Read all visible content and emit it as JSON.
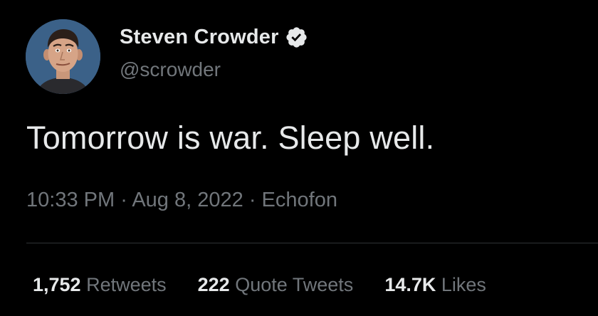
{
  "author": {
    "display_name": "Steven Crowder",
    "handle": "@scrowder",
    "verified": true,
    "avatar_icon": "profile-photo"
  },
  "tweet": {
    "text": "Tomorrow is war. Sleep well.",
    "time": "10:33 PM",
    "date": "Aug 8, 2022",
    "source": "Echofon",
    "separator": "·"
  },
  "stats": {
    "retweets_count": "1,752",
    "retweets_label": "Retweets",
    "quotes_count": "222",
    "quotes_label": "Quote Tweets",
    "likes_count": "14.7K",
    "likes_label": "Likes"
  },
  "colors": {
    "background": "#000000",
    "primary_text": "#e7e9ea",
    "secondary_text": "#71767b",
    "divider": "#2f3336",
    "verified_badge": "#e7e9ea"
  }
}
